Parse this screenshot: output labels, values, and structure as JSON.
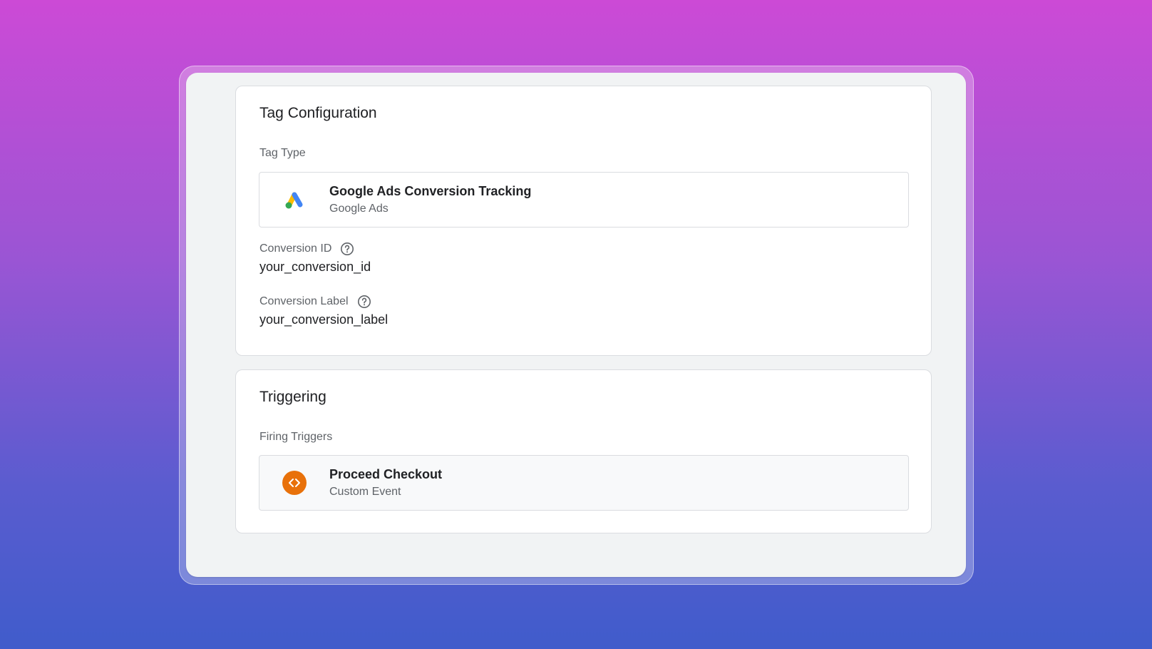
{
  "tag_configuration": {
    "title": "Tag Configuration",
    "tag_type_label": "Tag Type",
    "tag_type": {
      "name": "Google Ads Conversion Tracking",
      "provider": "Google Ads",
      "icon": "google-ads-logo"
    },
    "fields": [
      {
        "label": "Conversion ID",
        "value": "your_conversion_id",
        "icon": "help-circle-icon"
      },
      {
        "label": "Conversion Label",
        "value": "your_conversion_label",
        "icon": "help-circle-icon"
      }
    ]
  },
  "triggering": {
    "title": "Triggering",
    "firing_triggers_label": "Firing Triggers",
    "trigger": {
      "name": "Proceed Checkout",
      "type": "Custom Event",
      "icon": "code-brackets-icon",
      "icon_color": "#e8710a"
    }
  }
}
